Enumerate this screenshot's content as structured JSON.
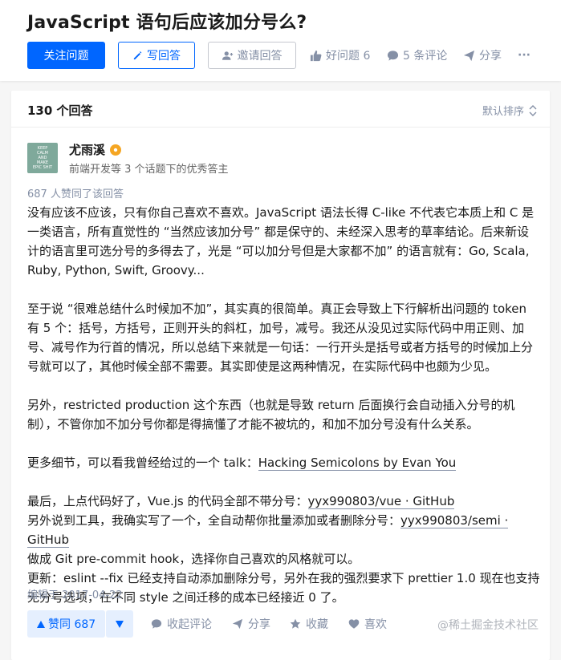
{
  "question": {
    "title": "JavaScript 语句后应该加分号么?",
    "follow_label": "关注问题",
    "write_label": "写回答",
    "invite_label": "邀请回答",
    "good_question_label": "好问题 6",
    "comments_label": "5 条评论",
    "share_label": "分享",
    "more_label": "···"
  },
  "answers_header": {
    "count_label": "130 个回答",
    "sort_label": "默认排序"
  },
  "answer": {
    "author_name": "尤雨溪",
    "author_bio": "前端开发等 3 个话题下的优秀答主",
    "avatar_text": [
      "KEEP",
      "CALM",
      "AND",
      "MAKE",
      "EPIC SHIT"
    ],
    "voters_label": "687 人赞同了该回答",
    "paragraphs": {
      "p1": "没有应该不应该，只有你自己喜欢不喜欢。JavaScript 语法长得 C-like 不代表它本质上和 C 是一类语言，所有直觉性的 “当然应该加分号” 都是保守的、未经深入思考的草率结论。后来新设计的语言里可选分号的多得去了，光是 “可以加分号但是大家都不加” 的语言就有：Go, Scala, Ruby, Python, Swift, Groovy...",
      "p2": "至于说 “很难总结什么时候加不加”，其实真的很简单。真正会导致上下行解析出问题的 token 有 5 个：括号，方括号，正则开头的斜杠，加号，减号。我还从没见过实际代码中用正则、加号、减号作为行首的情况，所以总结下来就是一句话：一行开头是括号或者方括号的时候加上分号就可以了，其他时候全部不需要。其实即使是这两种情况，在实际代码中也颇为少见。",
      "p3": "另外，restricted production 这个东西（也就是导致 return 后面换行会自动插入分号的机制），不管你加不加分号你都是得搞懂了才能不被坑的，和加不加分号没有什么关系。",
      "p4_prefix": "更多细节，可以看我曾经给过的一个 talk：",
      "p4_link": "Hacking Semicolons by Evan You",
      "p5_line1_prefix": "最后，上点代码好了，Vue.js 的代码全部不带分号：",
      "p5_line1_link": "yyx990803/vue · GitHub",
      "p5_line2_prefix": "另外说到工具，我确实写了一个，全自动帮你批量添加或者删除分号：",
      "p5_line2_link": "yyx990803/semi · GitHub",
      "p5_line3": "做成 Git pre-commit hook，选择你自己喜欢的风格就可以。",
      "p5_line4": "更新：eslint --fix 已经支持自动添加删除分号，另外在我的强烈要求下 prettier 1.0 现在也支持无分号选项，在不同 style 之间迁移的成本已经接近 0 了。"
    },
    "edited_label": "编辑于 2017-04-22",
    "footer": {
      "vote_up_label": "赞同 687",
      "comment_label": "收起评论",
      "share_label": "分享",
      "favorite_label": "收藏",
      "like_label": "喜欢"
    }
  },
  "watermark": "@稀土掘金技术社区",
  "colors": {
    "primary": "#0066ff",
    "muted": "#8590a6",
    "vote_bg": "#e5effe",
    "badge": "#f5a623"
  }
}
